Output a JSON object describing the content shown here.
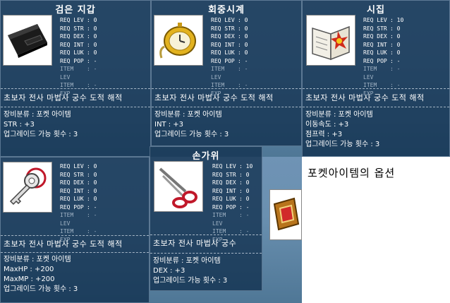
{
  "caption": "포켓아이템의 옵션",
  "items": [
    {
      "title": "검은 지갑",
      "icon": "black-wallet-icon",
      "req": [
        [
          "REQ LEV",
          ": 0"
        ],
        [
          "REQ STR",
          ": 0"
        ],
        [
          "REQ DEX",
          ": 0"
        ],
        [
          "REQ INT",
          ": 0"
        ],
        [
          "REQ LUK",
          ": 0"
        ],
        [
          "REQ POP",
          ": -"
        ]
      ],
      "dim": [
        [
          "ITEM LEV",
          ": -"
        ],
        [
          "ITEM EXP",
          ": -"
        ]
      ],
      "jobs": "초보자 전사 마법사 궁수 도적 해적",
      "lines": [
        "장비분류 : 포켓 아이템",
        "STR : +3",
        "업그레이드 가능 횟수 : 3"
      ]
    },
    {
      "title": "회중시계",
      "icon": "pocket-watch-icon",
      "req": [
        [
          "REQ LEV",
          ": 0"
        ],
        [
          "REQ STR",
          ": 0"
        ],
        [
          "REQ DEX",
          ": 0"
        ],
        [
          "REQ INT",
          ": 0"
        ],
        [
          "REQ LUK",
          ": 0"
        ],
        [
          "REQ POP",
          ": -"
        ]
      ],
      "dim": [
        [
          "ITEM LEV",
          ": -"
        ],
        [
          "ITEM EXP",
          ": -"
        ]
      ],
      "jobs": "초보자 전사 마법사 궁수 도적 해적",
      "lines": [
        "장비분류 : 포켓 아이템",
        "INT : +3",
        "업그레이드 가능 횟수 : 3"
      ]
    },
    {
      "title": "시집",
      "icon": "poetry-book-icon",
      "req": [
        [
          "REQ LEV",
          ": 10"
        ],
        [
          "REQ STR",
          ": 0"
        ],
        [
          "REQ DEX",
          ": 0"
        ],
        [
          "REQ INT",
          ": 0"
        ],
        [
          "REQ LUK",
          ": 0"
        ],
        [
          "REQ POP",
          ": -"
        ]
      ],
      "dim": [
        [
          "ITEM LEV",
          ": -"
        ],
        [
          "ITEM EXP",
          ": -"
        ]
      ],
      "jobs": "초보자 전사 마법사 궁수 도적 해적",
      "lines": [
        "장비분류 : 포켓 아이템",
        "이동속도 : +3",
        "점프력 : +3",
        "업그레이드 가능 횟수 : 3"
      ]
    },
    {
      "title": "",
      "icon": "key-icon",
      "req": [
        [
          "REQ LEV",
          ": 0"
        ],
        [
          "REQ STR",
          ": 0"
        ],
        [
          "REQ DEX",
          ": 0"
        ],
        [
          "REQ INT",
          ": 0"
        ],
        [
          "REQ LUK",
          ": 0"
        ],
        [
          "REQ POP",
          ": -"
        ]
      ],
      "dim": [
        [
          "ITEM LEV",
          ": -"
        ],
        [
          "ITEM EXP",
          ": -"
        ]
      ],
      "jobs": "초보자 전사 마법사 궁수 도적 해적",
      "lines": [
        "장비분류 : 포켓 아이템",
        "MaxHP : +200",
        "MaxMP : +200",
        "업그레이드 가능 횟수 : 3"
      ]
    },
    {
      "title": "손가위",
      "icon": "scissors-icon",
      "req": [
        [
          "REQ LEV",
          ": 10"
        ],
        [
          "REQ STR",
          ": 0"
        ],
        [
          "REQ DEX",
          ": 0"
        ],
        [
          "REQ INT",
          ": 0"
        ],
        [
          "REQ LUK",
          ": 0"
        ],
        [
          "REQ POP",
          ": -"
        ]
      ],
      "dim": [
        [
          "ITEM LEV",
          ": -"
        ],
        [
          "ITEM EXP",
          ": -"
        ]
      ],
      "jobs": "초보자 전사 마법사 궁수",
      "lines": [
        "장비분류 : 포켓 아이템",
        "DEX : +3",
        "업그레이드 가능 횟수 : 3"
      ]
    }
  ]
}
